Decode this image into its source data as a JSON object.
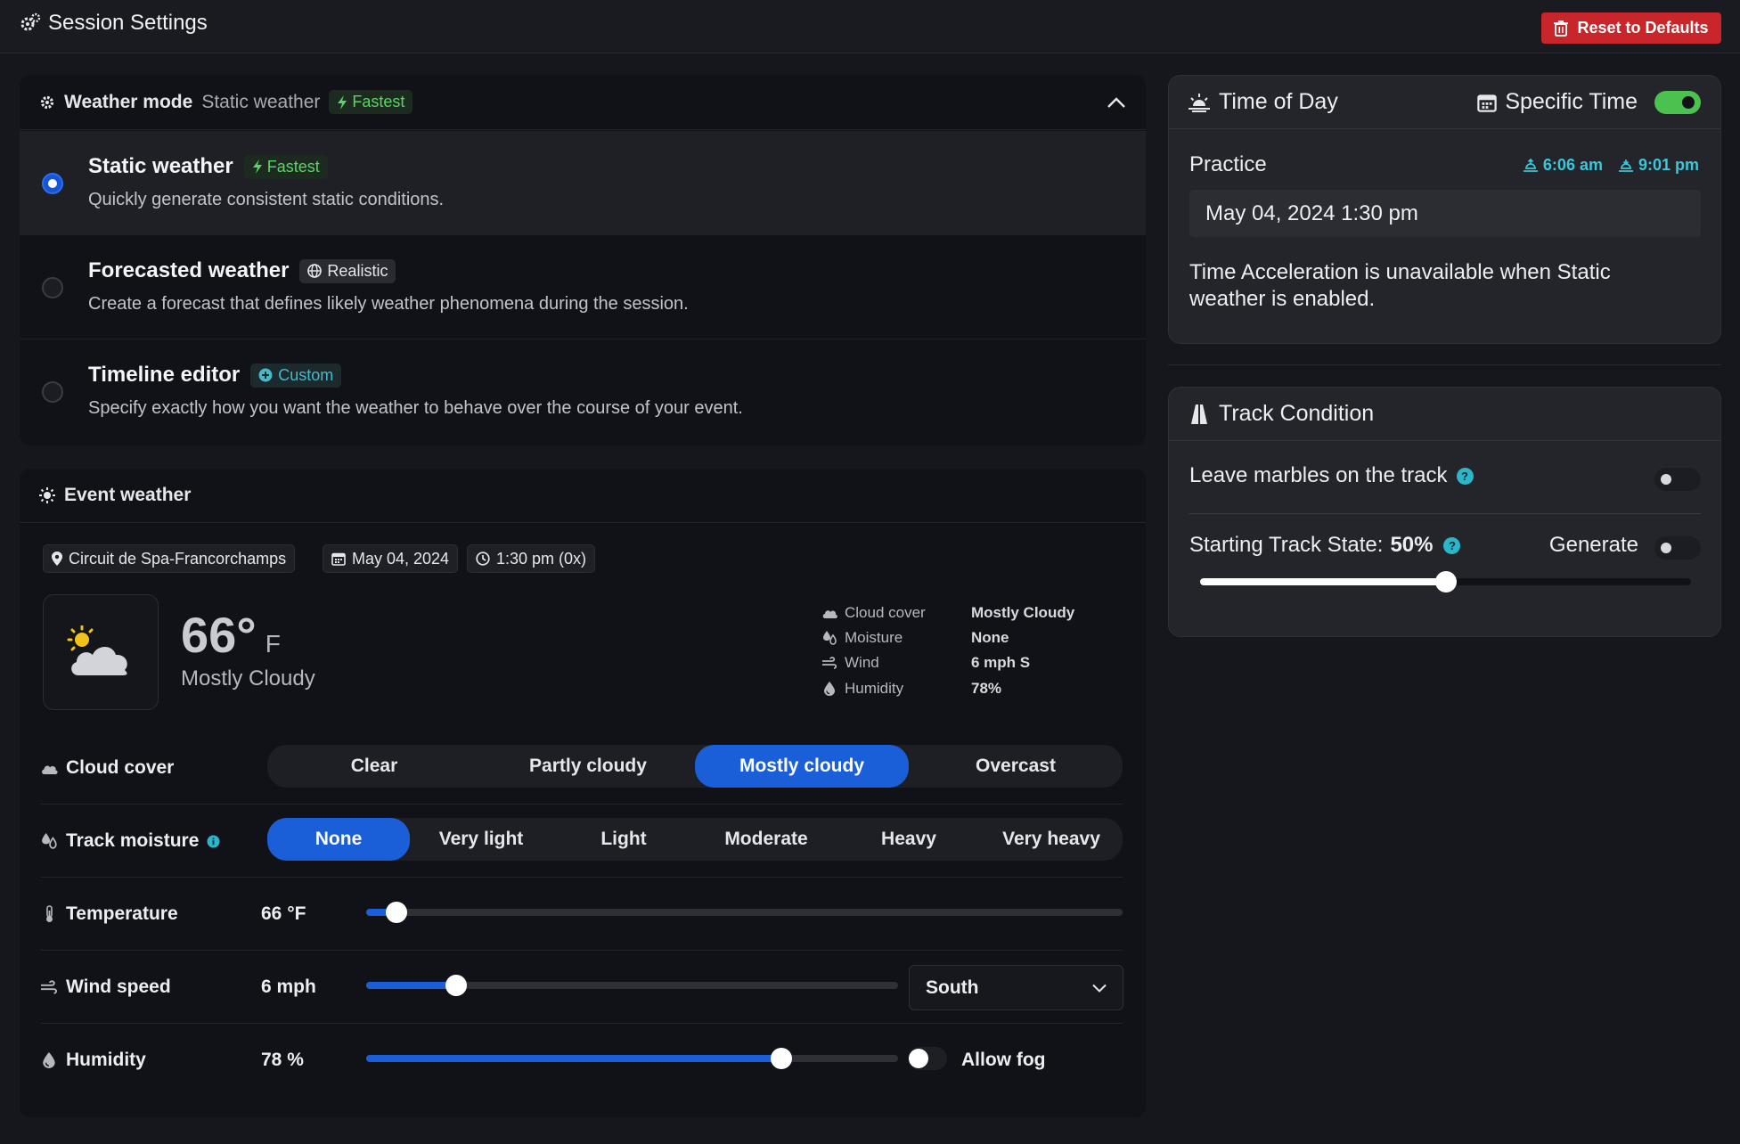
{
  "app": {
    "title": "Session Settings",
    "reset_label": "Reset to Defaults"
  },
  "weather_mode": {
    "label": "Weather mode",
    "current": "Static weather",
    "current_badge": "Fastest",
    "options": [
      {
        "title": "Static weather",
        "badge": "Fastest",
        "description": "Quickly generate consistent static conditions.",
        "selected": true
      },
      {
        "title": "Forecasted weather",
        "badge": "Realistic",
        "description": "Create a forecast that defines likely weather phenomena during the session.",
        "selected": false
      },
      {
        "title": "Timeline editor",
        "badge": "Custom",
        "description": "Specify exactly how you want the weather to behave over the course of your event.",
        "selected": false
      }
    ]
  },
  "event_weather": {
    "title": "Event weather",
    "location": "Circuit de Spa-Francorchamps",
    "date": "May 04, 2024",
    "time": "1:30 pm (0x)",
    "temperature": "66°",
    "temperature_unit": "F",
    "condition": "Mostly Cloudy",
    "stats": [
      {
        "label": "Cloud cover",
        "value": "Mostly Cloudy",
        "icon": "cloud-icon"
      },
      {
        "label": "Moisture",
        "value": "None",
        "icon": "droplets-icon"
      },
      {
        "label": "Wind",
        "value": "6 mph S",
        "icon": "wind-icon"
      },
      {
        "label": "Humidity",
        "value": "78%",
        "icon": "humidity-icon"
      }
    ],
    "cloud_cover": {
      "label": "Cloud cover",
      "options": [
        "Clear",
        "Partly cloudy",
        "Mostly cloudy",
        "Overcast"
      ],
      "selected": "Mostly cloudy"
    },
    "track_moisture": {
      "label": "Track moisture",
      "options": [
        "None",
        "Very light",
        "Light",
        "Moderate",
        "Heavy",
        "Very heavy"
      ],
      "selected": "None"
    },
    "temperature_row": {
      "label": "Temperature",
      "value": "66 °F",
      "level": 0.04
    },
    "wind_row": {
      "label": "Wind speed",
      "value": "6 mph",
      "level": 0.17,
      "direction": "South"
    },
    "humidity_row": {
      "label": "Humidity",
      "value": "78 %",
      "level": 0.78,
      "fog_label": "Allow fog",
      "allow_fog": false
    }
  },
  "time_of_day": {
    "title": "Time of Day",
    "specific_time_label": "Specific Time",
    "specific_time": true,
    "session": "Practice",
    "sunrise": "6:06 am",
    "sunset": "9:01 pm",
    "datetime": "May 04, 2024 1:30 pm",
    "note": "Time Acceleration is unavailable when Static weather is enabled."
  },
  "track_condition": {
    "title": "Track Condition",
    "marbles_label": "Leave marbles on the track",
    "marbles": false,
    "starting_state_label": "Starting Track State:",
    "starting_state_value": "50%",
    "starting_state_level": 0.5,
    "generate_label": "Generate",
    "generate": false
  },
  "colors": {
    "accent": "#1b5fd8",
    "danger": "#c8262a",
    "success": "#4bc24f",
    "teal": "#2cb6c9"
  }
}
